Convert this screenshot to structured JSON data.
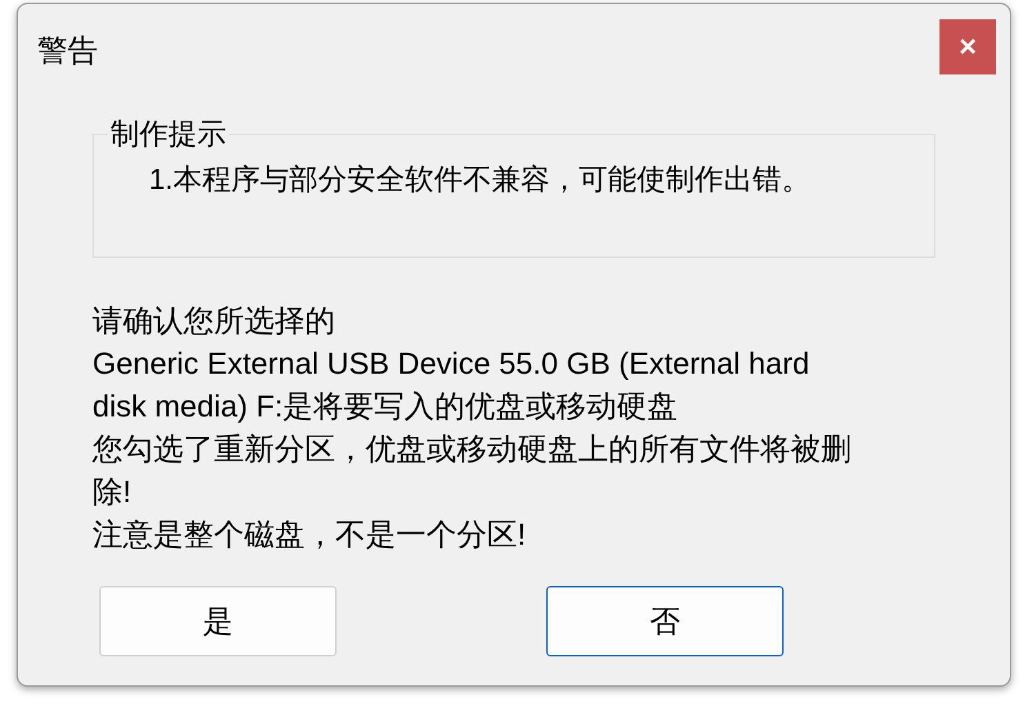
{
  "dialog": {
    "title": "警告",
    "close": "×"
  },
  "group": {
    "legend": "制作提示",
    "text": "1.本程序与部分安全软件不兼容，可能使制作出错。"
  },
  "message_lines": [
    "请确认您所选择的",
    "Generic External USB Device 55.0 GB (External hard",
    "disk media) F:是将要写入的优盘或移动硬盘",
    "您勾选了重新分区，优盘或移动硬盘上的所有文件将被删",
    "除!",
    "注意是整个磁盘，不是一个分区!"
  ],
  "buttons": [
    {
      "label": "是",
      "focused": false
    },
    {
      "label": "否",
      "focused": true
    }
  ]
}
